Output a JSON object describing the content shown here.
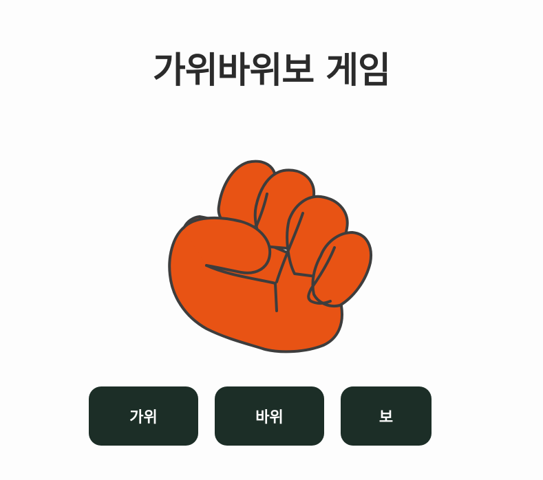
{
  "title": "가위바위보 게임",
  "hand": {
    "icon": "rock-fist-icon",
    "fill_color": "#e85314",
    "stroke_color": "#3d3d3d"
  },
  "buttons": {
    "scissors_label": "가위",
    "rock_label": "바위",
    "paper_label": "보"
  },
  "colors": {
    "background": "#fdfdfd",
    "title": "#2b2b2b",
    "button_bg": "#1c2e27",
    "button_text": "#ffffff"
  }
}
